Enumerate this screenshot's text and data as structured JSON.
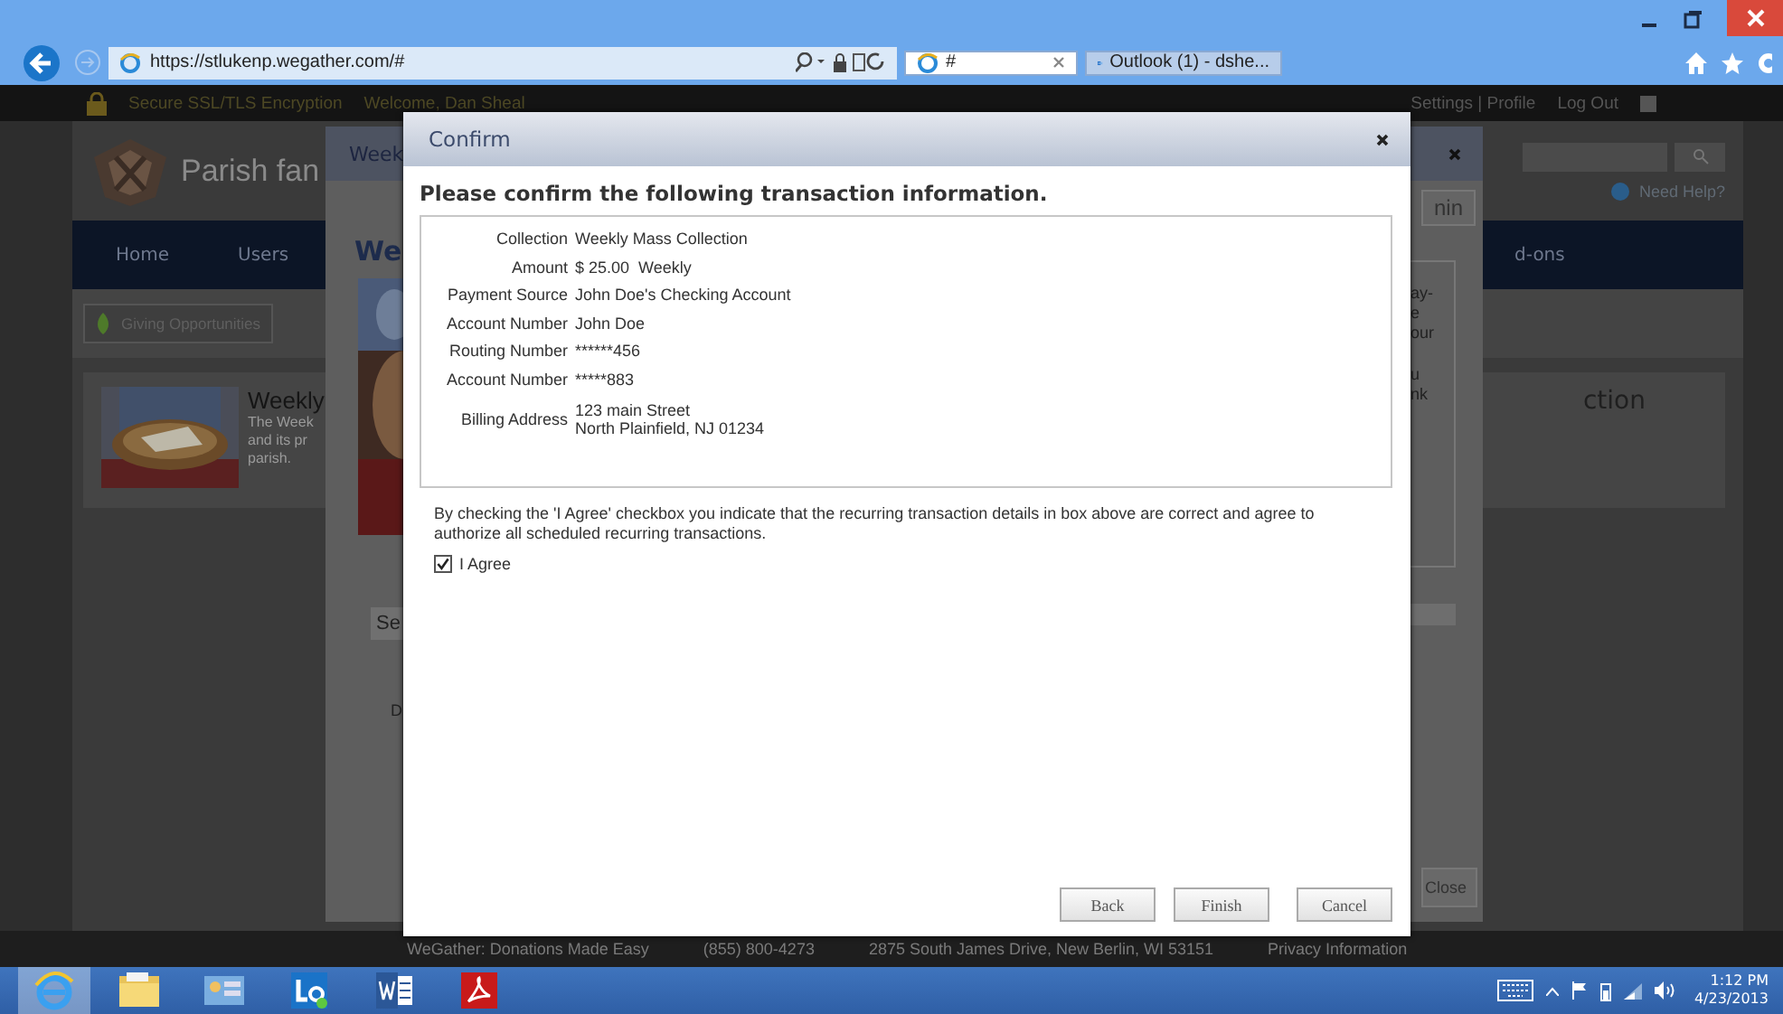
{
  "browser": {
    "address": "https://stlukenp.wegather.com/#",
    "tabs": [
      {
        "label": "#",
        "selected": true,
        "kind": "ie"
      },
      {
        "label": "Outlook (1) - dshe...",
        "selected": false,
        "kind": "outlook"
      }
    ]
  },
  "site_bar": {
    "security": "Secure SSL/TLS Encryption",
    "welcome": "Welcome, Dan Sheal",
    "links": "Settings | Profile",
    "logout": "Log Out"
  },
  "header": {
    "brand": "Parish fan",
    "help": "Need Help?"
  },
  "nav": [
    {
      "label": "Home"
    },
    {
      "label": "Users"
    },
    {
      "label": "d-ons"
    }
  ],
  "subnav": {
    "button": "Giving Opportunities"
  },
  "card": {
    "title": "Weekly",
    "lines": [
      "The Week",
      "and its pr",
      "parish."
    ],
    "right_fragment": "ction"
  },
  "back_dialog": {
    "title": "Week",
    "button": "nin",
    "heading": "We",
    "fragments": [
      "ay-",
      "e",
      "our",
      "u",
      "nk"
    ],
    "tab": "Se",
    "letter": "D",
    "close": "Close"
  },
  "dialog": {
    "title": "Confirm",
    "heading": "Please confirm the following transaction information.",
    "rows": [
      {
        "label": "Collection",
        "value": "Weekly Mass Collection"
      },
      {
        "label": "Amount",
        "value": "$ 25.00  Weekly"
      },
      {
        "label": "Payment Source",
        "value": "John Doe's Checking Account"
      },
      {
        "label": "Account Number",
        "value": "John Doe"
      },
      {
        "label": "Routing Number",
        "value": "******456"
      },
      {
        "label": "Account Number",
        "value": "*****883"
      },
      {
        "label": "Billing Address",
        "value": "123 main Street\nNorth Plainfield, NJ 01234"
      }
    ],
    "agreement": "By checking the 'I Agree' checkbox you indicate that the recurring transaction details in box above are correct and agree to authorize all scheduled recurring transactions.",
    "agree": {
      "label": "I Agree",
      "checked": true
    },
    "buttons": [
      "Back",
      "Finish",
      "Cancel"
    ]
  },
  "footer": [
    "WeGather: Donations Made Easy",
    "(855) 800-4273",
    "2875 South James Drive, New Berlin, WI 53151",
    "Privacy Information"
  ],
  "taskbar": {
    "apps": [
      {
        "kind": "ie",
        "selected": true
      },
      {
        "kind": "folder",
        "selected": false
      },
      {
        "kind": "panel",
        "selected": false
      },
      {
        "kind": "lync",
        "selected": false
      },
      {
        "kind": "word",
        "selected": false
      },
      {
        "kind": "pdf",
        "selected": false
      }
    ],
    "time": "1:12 PM",
    "date": "4/23/2013"
  }
}
